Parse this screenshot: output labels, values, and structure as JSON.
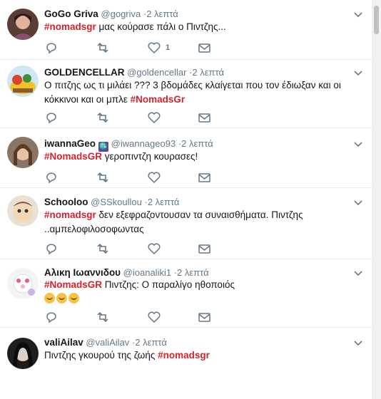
{
  "tweets": [
    {
      "name": "GoGo Griva",
      "handle": "@gogriva",
      "time": "2 λεπτά",
      "hashtag": "#nomadsgr",
      "text_after": " μας κούρασε πάλι ο Πιντζης...",
      "text_before": "",
      "like_count": "1"
    },
    {
      "name": "GOLDENCELLAR",
      "handle": "@goldencellar",
      "time": "2 λεπτά",
      "text_before": "Ο πιτζης ως τι μιλάει ??? 3 βδομάδες κλαίγεται που τον έδιωξαν και οι κόκκινοι και οι μπλε  ",
      "hashtag": "#NomadsGr",
      "text_after": ""
    },
    {
      "name": "iwannaGeo",
      "badge": "♏",
      "handle": "@iwannageo93",
      "time": "2 λεπτά",
      "text_before": "",
      "hashtag": "#NomadsGR",
      "text_after": " γεροπιντζη κουρασες!"
    },
    {
      "name": "Schooloo",
      "handle": "@SSkoullou",
      "time": "2 λεπτά",
      "text_before": "",
      "hashtag": "#nomadsgr",
      "text_after": " δεν εξεφραζοντουσαν τα συναισθήματα. Πιντζης ..αμπελοφιλοσοφωντας"
    },
    {
      "name": "Αλικη Ιωαννιδου",
      "handle": "@ioanaliki1",
      "time": "2 λεπτά",
      "text_before": "",
      "hashtag": "#NomadsGR",
      "text_after": " Πιντζης: Ο παραλίγο ηθοποιός"
    },
    {
      "name": "valiAilav",
      "handle": "@valiAilav",
      "time": "2 λεπτά",
      "text_before": "Πιντζης γκουρού της ζωής  ",
      "hashtag": "#nomadsgr",
      "text_after": ""
    }
  ],
  "separator": "·",
  "colors": {
    "hashtag": "#d4232a",
    "icon": "#657786",
    "divider": "#e6ecf0"
  }
}
